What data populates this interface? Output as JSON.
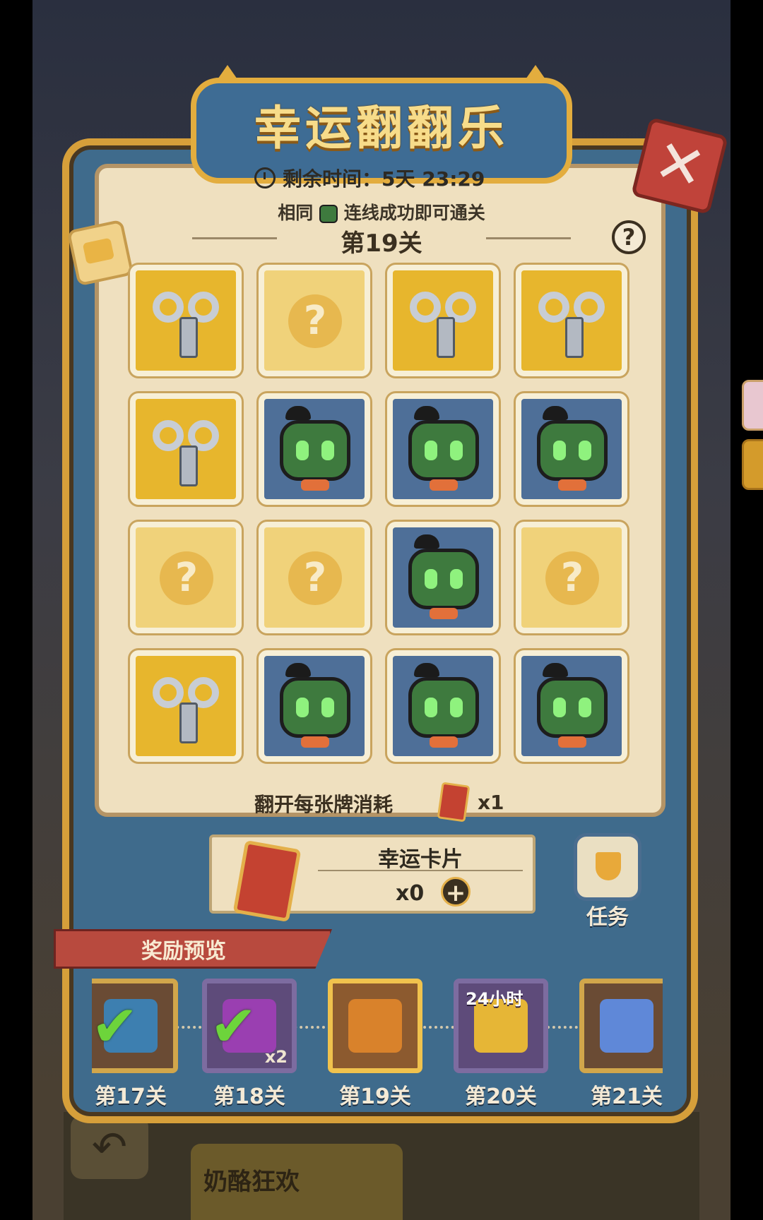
{
  "header": {
    "title": "幸运翻翻乐",
    "timer_label": "剩余时间：5天 23:29"
  },
  "board": {
    "instruction_pre": "相同",
    "instruction_post": "连线成功即可通关",
    "level": "第19关",
    "help_symbol": "?",
    "cards": [
      [
        "key",
        "hidden",
        "key",
        "key"
      ],
      [
        "key",
        "bot",
        "bot",
        "bot"
      ],
      [
        "hidden",
        "hidden",
        "bot",
        "hidden"
      ],
      [
        "key",
        "bot",
        "bot",
        "bot"
      ]
    ],
    "hidden_symbol": "?",
    "cost_text": "翻开每张牌消耗",
    "cost_qty": "x1"
  },
  "lucky_card": {
    "label": "幸运卡片",
    "count": "x0",
    "add_symbol": "+"
  },
  "task": {
    "label": "任务"
  },
  "rewards": {
    "title": "奖励预览",
    "items": [
      {
        "label": "第17关",
        "claimed": true,
        "style": "bronze"
      },
      {
        "label": "第18关",
        "claimed": true,
        "style": "purple",
        "qty": "x2"
      },
      {
        "label": "第19关",
        "claimed": false,
        "style": "gold"
      },
      {
        "label": "第20关",
        "claimed": false,
        "style": "purple",
        "badge": "24小时"
      },
      {
        "label": "第21关",
        "claimed": false,
        "style": "bronze"
      }
    ]
  },
  "background": {
    "footer_text": "奶酪狂欢"
  },
  "colors": {
    "panel_blue": "#3f6b8c",
    "gold_frame": "#d69f3a",
    "paper": "#efe0bf",
    "close_red": "#c0433a"
  }
}
